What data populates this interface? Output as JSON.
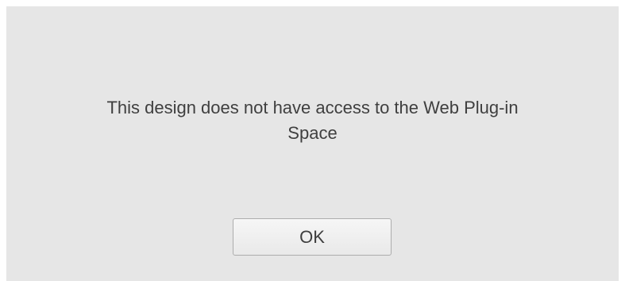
{
  "dialog": {
    "message_line1": "This design does not have access to the Web Plug-in",
    "message_line2": "Space",
    "ok_label": "OK"
  },
  "colors": {
    "dialog_background": "#e6e6e6",
    "text": "#3f3f3f",
    "button_border": "#adadad"
  }
}
